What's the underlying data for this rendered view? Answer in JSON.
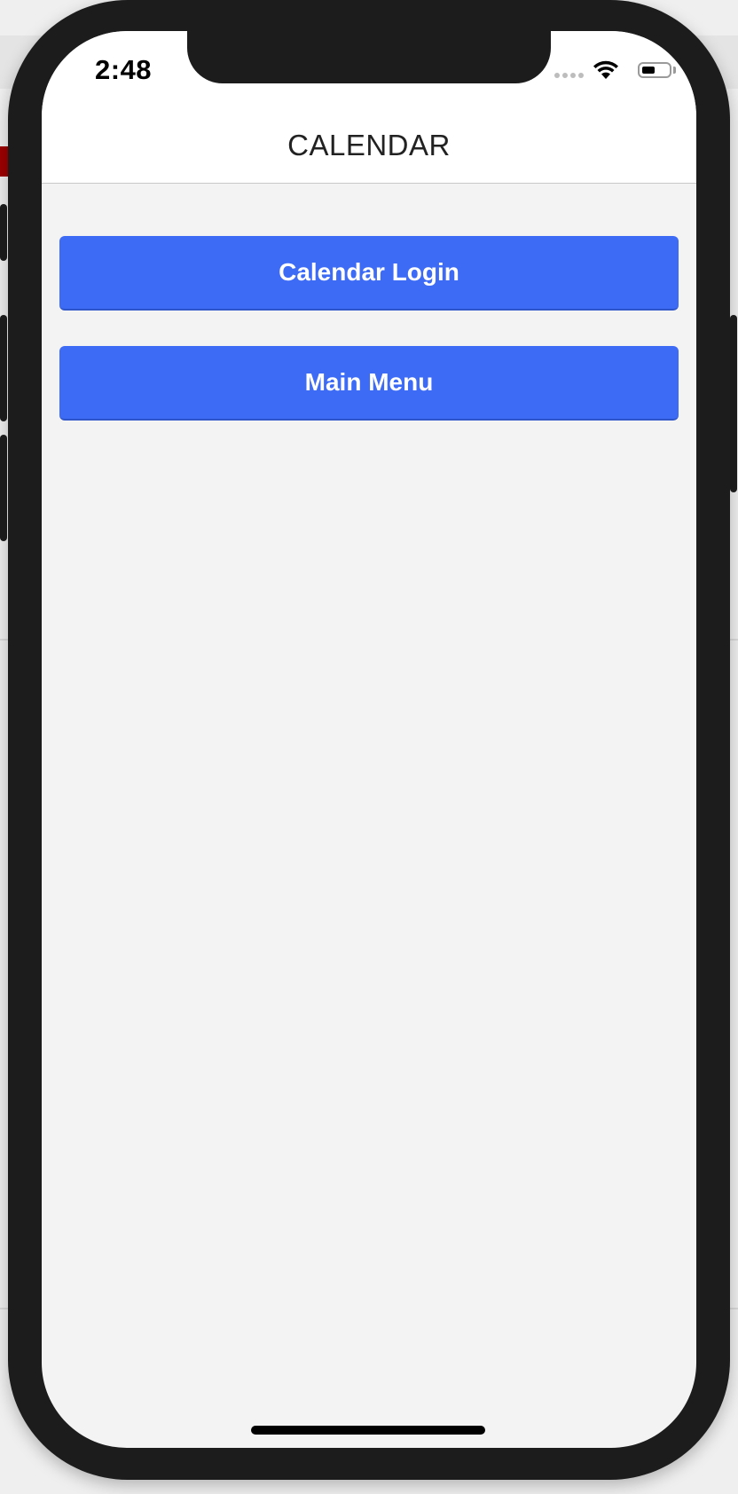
{
  "status_bar": {
    "time": "2:48",
    "icons": [
      "cellular-signal-icon",
      "wifi-icon",
      "battery-icon"
    ]
  },
  "nav": {
    "title": "CALENDAR"
  },
  "buttons": {
    "calendar_login": "Calendar Login",
    "main_menu": "Main Menu"
  },
  "colors": {
    "button_bg": "#3d6bf5",
    "screen_bg": "#f3f3f3",
    "bezel": "#1c1c1c"
  }
}
